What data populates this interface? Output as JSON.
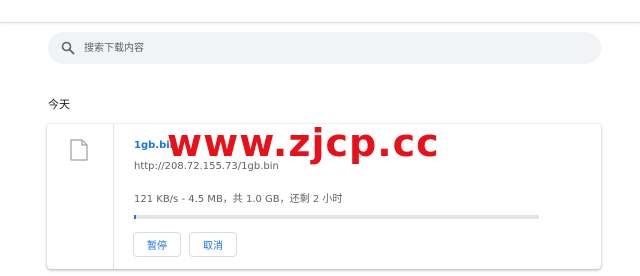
{
  "search": {
    "placeholder": "搜索下载内容"
  },
  "section": {
    "date_label": "今天"
  },
  "download": {
    "file_name": "1gb.bin",
    "url": "http://208.72.155.73/1gb.bin",
    "status": "121 KB/s - 4.5 MB，共 1.0 GB，还剩 2 小时",
    "progress_fraction": 0.0044,
    "pause_label": "暂停",
    "cancel_label": "取消"
  },
  "watermark": {
    "text": "www.zjcp.cc"
  },
  "colors": {
    "accent": "#1a73e8",
    "watermark": "#e8111a",
    "secondary_text": "#5f6368"
  },
  "icons": {
    "search": "search-icon",
    "file": "file-icon"
  }
}
